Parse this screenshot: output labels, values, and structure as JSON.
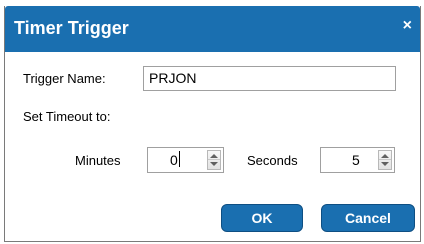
{
  "dialog": {
    "title": "Timer Trigger",
    "close_symbol": "×",
    "trigger_name_label": "Trigger Name:",
    "trigger_name_value": "PRJON",
    "set_timeout_label": "Set Timeout to:",
    "minutes_label": "Minutes",
    "minutes_value": "0",
    "seconds_label": "Seconds",
    "seconds_value": "5",
    "ok_label": "OK",
    "cancel_label": "Cancel"
  },
  "colors": {
    "title_bar": "#1a6fb0",
    "button": "#1a6fb0"
  }
}
